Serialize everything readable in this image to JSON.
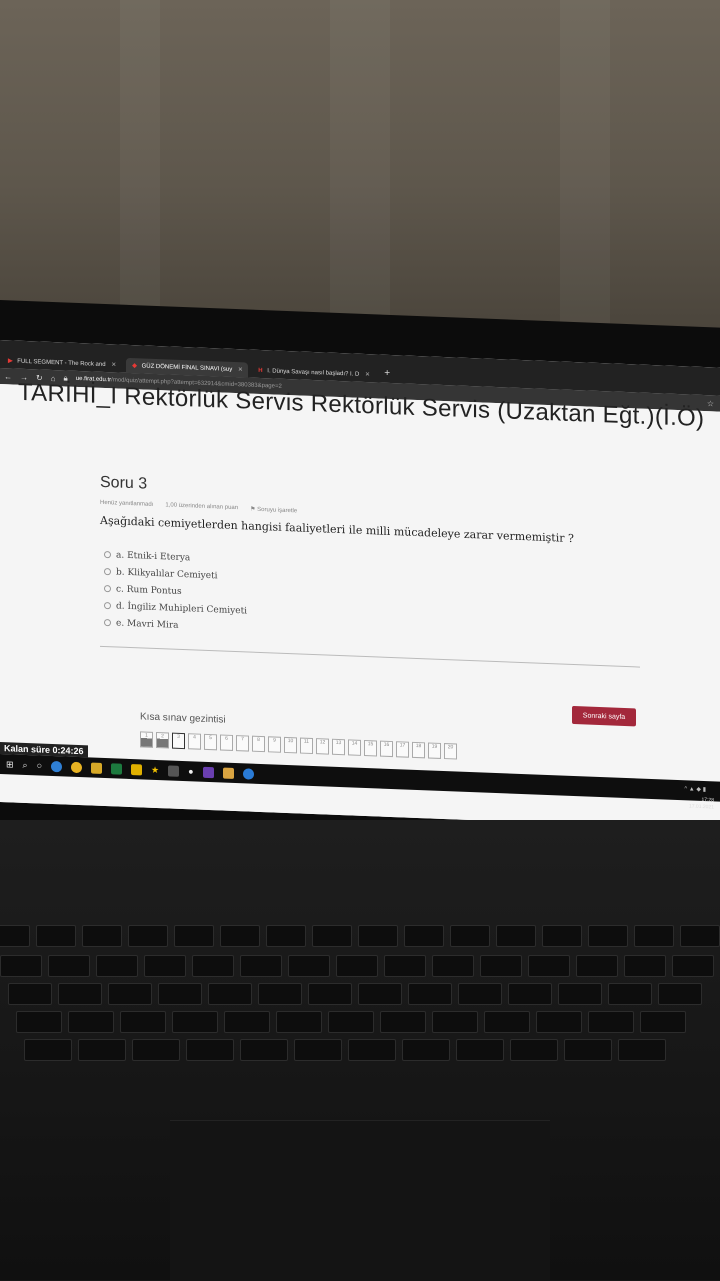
{
  "browser": {
    "tabs": [
      {
        "label": "FULL SEGMENT - The Rock and",
        "active": false
      },
      {
        "label": "GÜZ DÖNEMİ FİNAL SINAVI (suy",
        "active": true
      },
      {
        "label": "I. Dünya Savaşı nasıl başladı? I. D",
        "active": false
      }
    ],
    "new_tab": "+",
    "url_host": "ue.firat.edu.tr",
    "url_path": "/mod/quiz/attempt.php?attempt=632914&cmid=380383&page=2"
  },
  "page": {
    "course_title": "TARİHİ_I Rektörlük Servis Rektörlük Servis (Uzaktan Eğt.)(İ.Ö)",
    "question_heading": "Soru 3",
    "meta_status": "Henüz yanıtlanmadı",
    "meta_points": "1,00 üzerinden alınan puan",
    "meta_flag": "Soruyu işaretle",
    "question_text": "Aşağıdaki cemiyetlerden hangisi faaliyetleri ile milli mücadeleye zarar vermemiştir ?",
    "options": [
      "a. Etnik-i Eterya",
      "b. Klikyalılar Cemiyeti",
      "c. Rum Pontus",
      "d. İngiliz Muhipleri Cemiyeti",
      "e. Mavri Mira"
    ],
    "next_button": "Sonraki sayfa",
    "nav_label": "Kısa sınav gezintisi",
    "nav_numbers": [
      "1",
      "2",
      "3",
      "4",
      "5",
      "6",
      "7",
      "8",
      "9",
      "10",
      "11",
      "12",
      "13",
      "14",
      "15",
      "16",
      "17",
      "18",
      "19",
      "20"
    ],
    "answered": [
      1,
      2
    ],
    "current": 3,
    "timer": "Kalan süre 0:24:26"
  },
  "taskbar": {
    "time": "17:28",
    "date": "17.01.2021"
  },
  "colors": {
    "accent": "#a3283b",
    "screen_bg": "#f5f5f5",
    "tab_bar": "#222222"
  }
}
